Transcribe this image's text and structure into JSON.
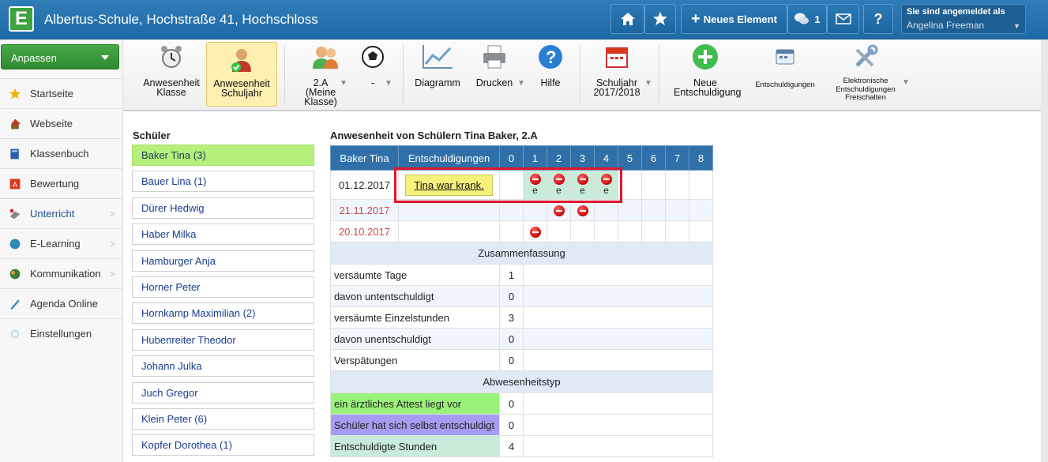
{
  "header": {
    "logo_letter": "E",
    "school": "Albertus-Schule, Hochstraße 41, Hochschloss",
    "new_element": "Neues Element",
    "messages_count": "1",
    "help": "?",
    "login_label": "Sie sind angemeldet als",
    "login_user": "Angelina Freeman"
  },
  "sidebar": {
    "customize": "Anpassen",
    "items": [
      {
        "label": "Startseite"
      },
      {
        "label": "Webseite"
      },
      {
        "label": "Klassenbuch"
      },
      {
        "label": "Bewertung"
      },
      {
        "label": "Unterricht"
      },
      {
        "label": "E-Learning"
      },
      {
        "label": "Kommunikation"
      },
      {
        "label": "Agenda Online"
      },
      {
        "label": "Einstellungen"
      }
    ]
  },
  "ribbon": {
    "b1": "Anwesenheit Klasse",
    "b2": "Anwesenheit Schuljahr",
    "b3": "2.A (Meine Klasse)",
    "b4": "-",
    "b5": "Diagramm",
    "b6": "Drucken",
    "b7": "Hilfe",
    "b8": "Schuljahr 2017/2018",
    "b9": "Neue Entschuldigung",
    "b10": "Entschuldigungen",
    "b11": "Elektronische Entschuldigungen Freischalten"
  },
  "students": {
    "title": "Schüler",
    "items": [
      "Baker Tina (3)",
      "Bauer Lina (1)",
      "Dürer Hedwig",
      "Haber Milka",
      "Hamburger Anja",
      "Horner Peter",
      "Hornkamp Maximilian (2)",
      "Hubenreiter Theodor",
      "Johann Julka",
      "Juch Gregor",
      "Klein Peter (6)",
      "Kopfer Dorothea (1)"
    ]
  },
  "attendance": {
    "title": "Anwesenheit von Schülern Tina Baker, 2.A",
    "col_name": "Baker Tina",
    "col_excuse": "Entschuldigungen",
    "periods": [
      "0",
      "1",
      "2",
      "3",
      "4",
      "5",
      "6",
      "7",
      "8"
    ],
    "rows": [
      {
        "date": "01.12.2017",
        "excuse": "Tina war krank.",
        "marks": "e"
      },
      {
        "date": "21.11.2017"
      },
      {
        "date": "20.10.2017"
      }
    ],
    "summary_title": "Zusammenfassung",
    "summary": [
      {
        "label": "versäumte Tage",
        "value": "1"
      },
      {
        "label": "davon untentschuldigt",
        "value": "0"
      },
      {
        "label": "versäumte Einzelstunden",
        "value": "3"
      },
      {
        "label": "davon unentschuldigt",
        "value": "0"
      },
      {
        "label": "Verspätungen",
        "value": "0"
      }
    ],
    "types_title": "Abwesenheitstyp",
    "types": [
      {
        "label": "ein ärztliches Attest liegt vor",
        "value": "0",
        "color": "#9bf27a"
      },
      {
        "label": "Schüler hat sich selbst entschuldigt",
        "value": "0",
        "color": "#a39cf0"
      },
      {
        "label": "Entschuldigte Stunden",
        "value": "4",
        "color": "#c8ecd8"
      }
    ]
  }
}
